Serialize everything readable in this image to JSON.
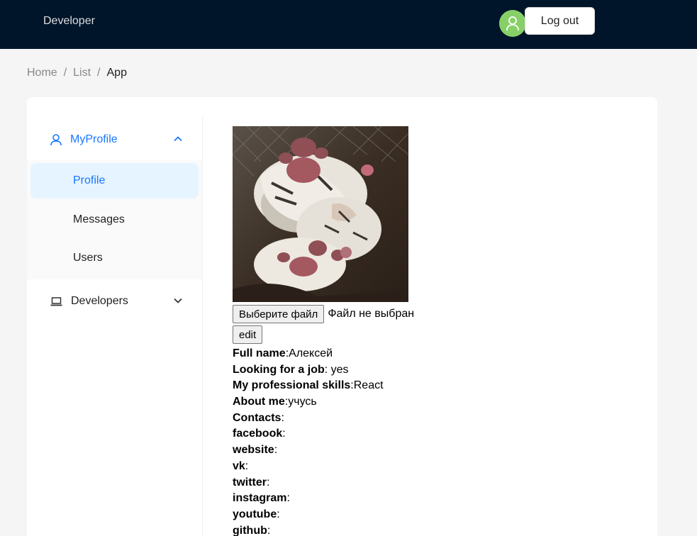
{
  "header": {
    "brand": "Developer",
    "logout_label": "Log out",
    "avatar_color": "#87d068"
  },
  "breadcrumb": {
    "items": [
      "Home",
      "List",
      "App"
    ]
  },
  "sidebar": {
    "groups": [
      {
        "label": "MyProfile",
        "icon": "user-icon",
        "expanded": true,
        "items": [
          {
            "label": "Profile",
            "selected": true
          },
          {
            "label": "Messages"
          },
          {
            "label": "Users"
          }
        ]
      },
      {
        "label": "Developers",
        "icon": "laptop-icon",
        "expanded": false
      }
    ],
    "accent_color": "#1677ff"
  },
  "profile": {
    "file_button_label": "Выберите файл",
    "file_status": "Файл не выбран",
    "edit_label": "edit",
    "fields": [
      {
        "label": "Full name",
        "sep": ":",
        "value": "Алексей"
      },
      {
        "label": "Looking for a job",
        "sep": ": ",
        "value": "yes"
      },
      {
        "label": "My professional skills",
        "sep": ":",
        "value": "React"
      },
      {
        "label": "About me",
        "sep": ":",
        "value": "учусь"
      },
      {
        "label": "Contacts",
        "sep": ":",
        "value": ""
      },
      {
        "label": "facebook",
        "sep": ":",
        "value": ""
      },
      {
        "label": "website",
        "sep": ":",
        "value": ""
      },
      {
        "label": "vk",
        "sep": ":",
        "value": ""
      },
      {
        "label": "twitter",
        "sep": ":",
        "value": ""
      },
      {
        "label": "instagram",
        "sep": ":",
        "value": ""
      },
      {
        "label": "youtube",
        "sep": ":",
        "value": ""
      },
      {
        "label": "github",
        "sep": ":",
        "value": ""
      }
    ]
  }
}
